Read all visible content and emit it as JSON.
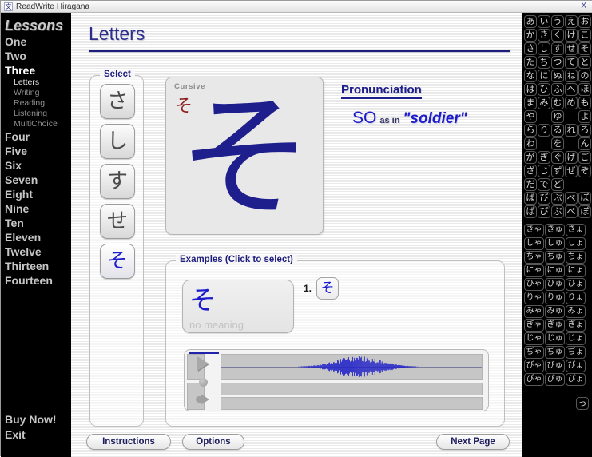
{
  "window": {
    "title": "ReadWrite Hiragana",
    "icon": "app-icon",
    "close_label": "X"
  },
  "sidebar": {
    "heading": "Lessons",
    "lessons": [
      {
        "label": "One",
        "active": false
      },
      {
        "label": "Two",
        "active": false
      },
      {
        "label": "Three",
        "active": true
      },
      {
        "label": "Four",
        "active": false
      },
      {
        "label": "Five",
        "active": false
      },
      {
        "label": "Six",
        "active": false
      },
      {
        "label": "Seven",
        "active": false
      },
      {
        "label": "Eight",
        "active": false
      },
      {
        "label": "Nine",
        "active": false
      },
      {
        "label": "Ten",
        "active": false
      },
      {
        "label": "Eleven",
        "active": false
      },
      {
        "label": "Twelve",
        "active": false
      },
      {
        "label": "Thirteen",
        "active": false
      },
      {
        "label": "Fourteen",
        "active": false
      }
    ],
    "sublessons": [
      {
        "label": "Letters",
        "active": true
      },
      {
        "label": "Writing",
        "active": false
      },
      {
        "label": "Reading",
        "active": false
      },
      {
        "label": "Listening",
        "active": false
      },
      {
        "label": "MultiChoice",
        "active": false
      }
    ],
    "footer_links": [
      {
        "label": "Buy Now!"
      },
      {
        "label": "Exit"
      }
    ]
  },
  "content": {
    "page_title": "Letters",
    "select": {
      "legend": "Select",
      "options": [
        {
          "kana": "さ",
          "selected": false
        },
        {
          "kana": "し",
          "selected": false
        },
        {
          "kana": "す",
          "selected": false
        },
        {
          "kana": "せ",
          "selected": false
        },
        {
          "kana": "そ",
          "selected": true
        }
      ]
    },
    "cursive": {
      "label": "Cursive",
      "small_kana": "そ",
      "big_kana": "そ"
    },
    "pronunciation": {
      "title": "Pronunciation",
      "syllable": "SO",
      "as_in": "as in",
      "word": "\"soldier\""
    },
    "examples": {
      "legend": "Examples (Click to select)",
      "card": {
        "kana": "そ",
        "meaning": "no meaning"
      },
      "items": [
        {
          "index": "1.",
          "kana": "そ"
        }
      ]
    },
    "buttons": {
      "instructions": "Instructions",
      "options": "Options",
      "next_page": "Next Page"
    }
  },
  "kana_chart": {
    "rows": [
      [
        "あ",
        "い",
        "う",
        "え",
        "お"
      ],
      [
        "か",
        "き",
        "く",
        "け",
        "こ"
      ],
      [
        "さ",
        "し",
        "す",
        "せ",
        "そ"
      ],
      [
        "た",
        "ち",
        "つ",
        "て",
        "と"
      ],
      [
        "な",
        "に",
        "ぬ",
        "ね",
        "の"
      ],
      [
        "は",
        "ひ",
        "ふ",
        "へ",
        "ほ"
      ],
      [
        "ま",
        "み",
        "む",
        "め",
        "も"
      ],
      [
        "や",
        "",
        "ゆ",
        "",
        "よ"
      ],
      [
        "ら",
        "り",
        "る",
        "れ",
        "ろ"
      ],
      [
        "わ",
        "",
        "を",
        "",
        "ん"
      ],
      [
        "が",
        "ぎ",
        "ぐ",
        "げ",
        "ご"
      ],
      [
        "ざ",
        "じ",
        "ず",
        "ぜ",
        "ぞ"
      ],
      [
        "だ",
        "で",
        "ど",
        "",
        ""
      ],
      [
        "ば",
        "び",
        "ぶ",
        "べ",
        "ぼ"
      ],
      [
        "ぱ",
        "ぴ",
        "ぷ",
        "ぺ",
        "ぽ"
      ]
    ],
    "digraph_rows": [
      [
        "きゃ",
        "きゅ",
        "きょ"
      ],
      [
        "しゃ",
        "しゅ",
        "しょ"
      ],
      [
        "ちゃ",
        "ちゅ",
        "ちょ"
      ],
      [
        "にゃ",
        "にゅ",
        "にょ"
      ],
      [
        "ひゃ",
        "ひゅ",
        "ひょ"
      ],
      [
        "りゃ",
        "りゅ",
        "りょ"
      ],
      [
        "みゃ",
        "みゅ",
        "みょ"
      ],
      [
        "ぎゃ",
        "ぎゅ",
        "ぎょ"
      ],
      [
        "じゃ",
        "じゅ",
        "じょ"
      ],
      [
        "ぢゃ",
        "ぢゅ",
        "ぢょ"
      ],
      [
        "びゃ",
        "びゅ",
        "びょ"
      ],
      [
        "ぴゃ",
        "ぴゅ",
        "ぴょ"
      ]
    ],
    "sokuon": "っ"
  },
  "colors": {
    "accent_blue": "#1d1d8c",
    "kana_blue": "#1c1ccc",
    "cursive_red": "#8c1c1c",
    "sidebar_bg": "#000000"
  }
}
